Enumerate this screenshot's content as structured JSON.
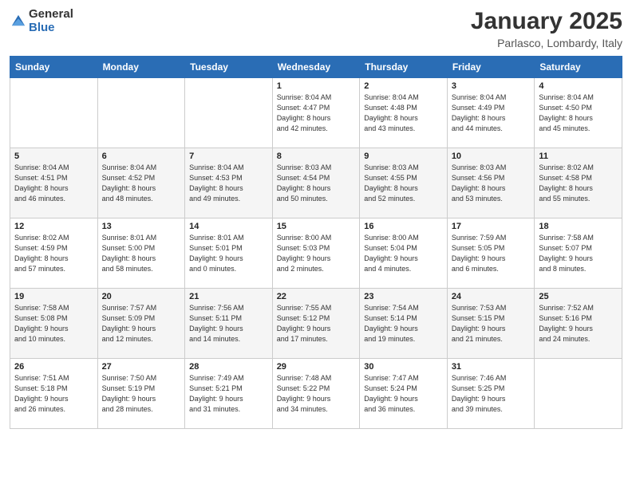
{
  "header": {
    "logo_general": "General",
    "logo_blue": "Blue",
    "month": "January 2025",
    "location": "Parlasco, Lombardy, Italy"
  },
  "days_of_week": [
    "Sunday",
    "Monday",
    "Tuesday",
    "Wednesday",
    "Thursday",
    "Friday",
    "Saturday"
  ],
  "weeks": [
    [
      {
        "day": "",
        "info": ""
      },
      {
        "day": "",
        "info": ""
      },
      {
        "day": "",
        "info": ""
      },
      {
        "day": "1",
        "info": "Sunrise: 8:04 AM\nSunset: 4:47 PM\nDaylight: 8 hours\nand 42 minutes."
      },
      {
        "day": "2",
        "info": "Sunrise: 8:04 AM\nSunset: 4:48 PM\nDaylight: 8 hours\nand 43 minutes."
      },
      {
        "day": "3",
        "info": "Sunrise: 8:04 AM\nSunset: 4:49 PM\nDaylight: 8 hours\nand 44 minutes."
      },
      {
        "day": "4",
        "info": "Sunrise: 8:04 AM\nSunset: 4:50 PM\nDaylight: 8 hours\nand 45 minutes."
      }
    ],
    [
      {
        "day": "5",
        "info": "Sunrise: 8:04 AM\nSunset: 4:51 PM\nDaylight: 8 hours\nand 46 minutes."
      },
      {
        "day": "6",
        "info": "Sunrise: 8:04 AM\nSunset: 4:52 PM\nDaylight: 8 hours\nand 48 minutes."
      },
      {
        "day": "7",
        "info": "Sunrise: 8:04 AM\nSunset: 4:53 PM\nDaylight: 8 hours\nand 49 minutes."
      },
      {
        "day": "8",
        "info": "Sunrise: 8:03 AM\nSunset: 4:54 PM\nDaylight: 8 hours\nand 50 minutes."
      },
      {
        "day": "9",
        "info": "Sunrise: 8:03 AM\nSunset: 4:55 PM\nDaylight: 8 hours\nand 52 minutes."
      },
      {
        "day": "10",
        "info": "Sunrise: 8:03 AM\nSunset: 4:56 PM\nDaylight: 8 hours\nand 53 minutes."
      },
      {
        "day": "11",
        "info": "Sunrise: 8:02 AM\nSunset: 4:58 PM\nDaylight: 8 hours\nand 55 minutes."
      }
    ],
    [
      {
        "day": "12",
        "info": "Sunrise: 8:02 AM\nSunset: 4:59 PM\nDaylight: 8 hours\nand 57 minutes."
      },
      {
        "day": "13",
        "info": "Sunrise: 8:01 AM\nSunset: 5:00 PM\nDaylight: 8 hours\nand 58 minutes."
      },
      {
        "day": "14",
        "info": "Sunrise: 8:01 AM\nSunset: 5:01 PM\nDaylight: 9 hours\nand 0 minutes."
      },
      {
        "day": "15",
        "info": "Sunrise: 8:00 AM\nSunset: 5:03 PM\nDaylight: 9 hours\nand 2 minutes."
      },
      {
        "day": "16",
        "info": "Sunrise: 8:00 AM\nSunset: 5:04 PM\nDaylight: 9 hours\nand 4 minutes."
      },
      {
        "day": "17",
        "info": "Sunrise: 7:59 AM\nSunset: 5:05 PM\nDaylight: 9 hours\nand 6 minutes."
      },
      {
        "day": "18",
        "info": "Sunrise: 7:58 AM\nSunset: 5:07 PM\nDaylight: 9 hours\nand 8 minutes."
      }
    ],
    [
      {
        "day": "19",
        "info": "Sunrise: 7:58 AM\nSunset: 5:08 PM\nDaylight: 9 hours\nand 10 minutes."
      },
      {
        "day": "20",
        "info": "Sunrise: 7:57 AM\nSunset: 5:09 PM\nDaylight: 9 hours\nand 12 minutes."
      },
      {
        "day": "21",
        "info": "Sunrise: 7:56 AM\nSunset: 5:11 PM\nDaylight: 9 hours\nand 14 minutes."
      },
      {
        "day": "22",
        "info": "Sunrise: 7:55 AM\nSunset: 5:12 PM\nDaylight: 9 hours\nand 17 minutes."
      },
      {
        "day": "23",
        "info": "Sunrise: 7:54 AM\nSunset: 5:14 PM\nDaylight: 9 hours\nand 19 minutes."
      },
      {
        "day": "24",
        "info": "Sunrise: 7:53 AM\nSunset: 5:15 PM\nDaylight: 9 hours\nand 21 minutes."
      },
      {
        "day": "25",
        "info": "Sunrise: 7:52 AM\nSunset: 5:16 PM\nDaylight: 9 hours\nand 24 minutes."
      }
    ],
    [
      {
        "day": "26",
        "info": "Sunrise: 7:51 AM\nSunset: 5:18 PM\nDaylight: 9 hours\nand 26 minutes."
      },
      {
        "day": "27",
        "info": "Sunrise: 7:50 AM\nSunset: 5:19 PM\nDaylight: 9 hours\nand 28 minutes."
      },
      {
        "day": "28",
        "info": "Sunrise: 7:49 AM\nSunset: 5:21 PM\nDaylight: 9 hours\nand 31 minutes."
      },
      {
        "day": "29",
        "info": "Sunrise: 7:48 AM\nSunset: 5:22 PM\nDaylight: 9 hours\nand 34 minutes."
      },
      {
        "day": "30",
        "info": "Sunrise: 7:47 AM\nSunset: 5:24 PM\nDaylight: 9 hours\nand 36 minutes."
      },
      {
        "day": "31",
        "info": "Sunrise: 7:46 AM\nSunset: 5:25 PM\nDaylight: 9 hours\nand 39 minutes."
      },
      {
        "day": "",
        "info": ""
      }
    ]
  ]
}
